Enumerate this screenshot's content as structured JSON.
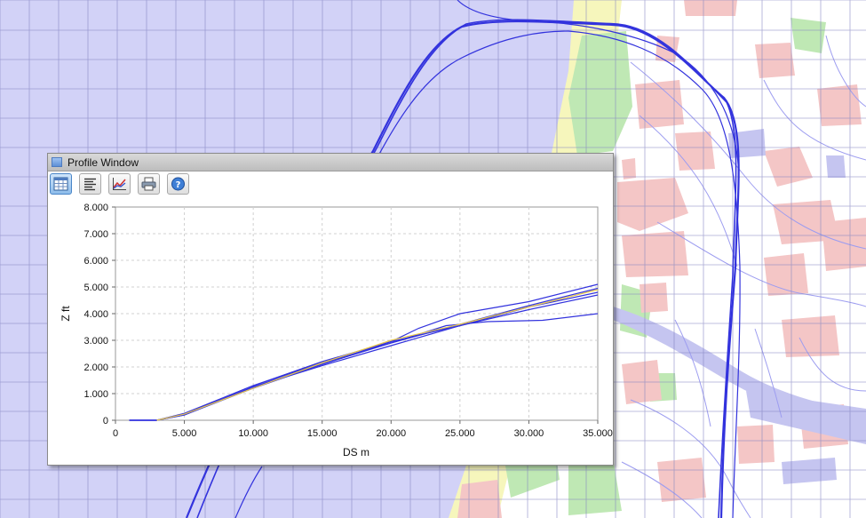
{
  "window": {
    "title": "Profile Window",
    "toolbar": [
      {
        "name": "table-view-button",
        "icon": "table-icon",
        "active": true
      },
      {
        "name": "text-view-button",
        "icon": "text-lines-icon",
        "active": false
      },
      {
        "name": "chart-view-button",
        "icon": "line-chart-icon",
        "active": false
      },
      {
        "name": "print-button",
        "icon": "printer-icon",
        "active": false
      },
      {
        "name": "help-button",
        "icon": "help-icon",
        "active": false
      }
    ]
  },
  "colors": {
    "sea": "#d2d2f7",
    "beach": "#f6f6bc",
    "land": "#ffffff",
    "built": "#f4c6c6",
    "green": "#bfe8b4",
    "track": "#3333dd",
    "profile_highlight": "#e8c84a"
  },
  "chart_data": {
    "type": "line",
    "xlabel": "DS m",
    "ylabel": "Z ft",
    "xlim": [
      0,
      35000
    ],
    "ylim": [
      0,
      8000
    ],
    "xticks": [
      "0",
      "5.000",
      "10.000",
      "15.000",
      "20.000",
      "25.000",
      "30.000",
      "35.000"
    ],
    "yticks": [
      "0",
      "1.000",
      "2.000",
      "3.000",
      "4.000",
      "5.000",
      "6.000",
      "7.000",
      "8.000"
    ],
    "grid": true,
    "series": [
      {
        "color": "#3333dd",
        "x": [
          1000,
          3000,
          5000,
          10000,
          15000,
          20000,
          22000,
          25000,
          30000,
          35000
        ],
        "y": [
          0,
          0,
          200,
          1200,
          2100,
          2950,
          3450,
          4000,
          4450,
          5100
        ]
      },
      {
        "color": "#3333dd",
        "x": [
          1000,
          3000,
          5000,
          10000,
          15000,
          20000,
          25000,
          30000,
          35000
        ],
        "y": [
          0,
          0,
          250,
          1300,
          2150,
          2900,
          3600,
          4300,
          4950
        ]
      },
      {
        "color": "#3333dd",
        "x": [
          1000,
          3000,
          5000,
          10000,
          15000,
          20000,
          25000,
          30000,
          35000
        ],
        "y": [
          0,
          0,
          220,
          1250,
          2050,
          2800,
          3550,
          4250,
          4800
        ]
      },
      {
        "color": "#3333dd",
        "x": [
          1000,
          3000,
          5000,
          10000,
          15000,
          20000,
          24000,
          27000,
          31000,
          35000
        ],
        "y": [
          0,
          0,
          200,
          1250,
          2100,
          2900,
          3550,
          3700,
          3750,
          4000
        ]
      },
      {
        "color": "#3333dd",
        "x": [
          1000,
          3000,
          5000,
          10000,
          15000,
          20000,
          25000,
          30000,
          35000
        ],
        "y": [
          0,
          0,
          260,
          1300,
          2200,
          2950,
          3550,
          4150,
          4700
        ]
      },
      {
        "color": "#e8c84a",
        "x": [
          3000,
          5000,
          10000,
          15000,
          20000,
          25000,
          30000,
          35000
        ],
        "y": [
          0,
          230,
          1200,
          2150,
          3000,
          3600,
          4250,
          4900
        ]
      }
    ]
  }
}
